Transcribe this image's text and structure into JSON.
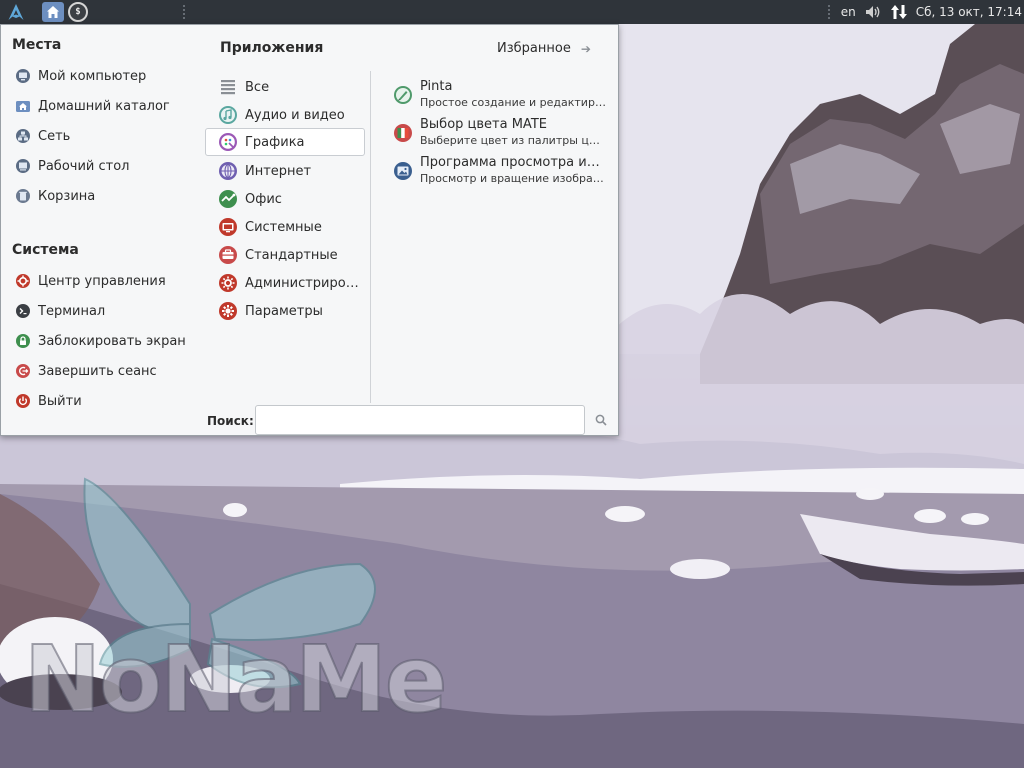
{
  "panel": {
    "keyboard_layout": "en",
    "clock": "Сб, 13 окт, 17:14",
    "terminal_launcher_glyph": "$"
  },
  "menu": {
    "places": {
      "title": "Места",
      "items": [
        {
          "label": "Мой компьютер",
          "icon": "computer-icon"
        },
        {
          "label": "Домашний каталог",
          "icon": "home-folder-icon"
        },
        {
          "label": "Сеть",
          "icon": "network-icon"
        },
        {
          "label": "Рабочий стол",
          "icon": "desktop-icon"
        },
        {
          "label": "Корзина",
          "icon": "trash-icon"
        }
      ]
    },
    "system": {
      "title": "Система",
      "items": [
        {
          "label": "Центр управления",
          "icon": "control-center-icon"
        },
        {
          "label": "Терминал",
          "icon": "terminal-icon"
        },
        {
          "label": "Заблокировать экран",
          "icon": "lock-icon"
        },
        {
          "label": "Завершить сеанс",
          "icon": "logout-icon"
        },
        {
          "label": "Выйти",
          "icon": "power-icon"
        }
      ]
    },
    "applications": {
      "title": "Приложения",
      "favorites_label": "Избранное",
      "categories": [
        {
          "label": "Все",
          "icon": "all-apps-icon",
          "color": "#8a8f95"
        },
        {
          "label": "Аудио и видео",
          "icon": "multimedia-icon",
          "color": "#5aa7a0"
        },
        {
          "label": "Графика",
          "icon": "graphics-icon",
          "color": "#9b59b6",
          "active": true
        },
        {
          "label": "Интернет",
          "icon": "internet-icon",
          "color": "#6f5fb0"
        },
        {
          "label": "Офис",
          "icon": "office-icon",
          "color": "#3e8f4e"
        },
        {
          "label": "Системные",
          "icon": "system-tools-icon",
          "color": "#c0392b"
        },
        {
          "label": "Стандартные",
          "icon": "accessories-icon",
          "color": "#c84a4a"
        },
        {
          "label": "Администриро…",
          "icon": "administration-icon",
          "color": "#c0392b"
        },
        {
          "label": "Параметры",
          "icon": "preferences-icon",
          "color": "#c0392b"
        }
      ],
      "apps": [
        {
          "name": "Pinta",
          "description": "Простое создание и редактиров…",
          "icon": "pinta-icon"
        },
        {
          "name": "Выбор цвета MATE",
          "description": "Выберите цвет из палитры цвет…",
          "icon": "color-picker-icon"
        },
        {
          "name": "Программа просмотра изо…",
          "description": "Просмотр и вращение изображе…",
          "icon": "image-viewer-icon"
        }
      ]
    },
    "search": {
      "label": "Поиск:",
      "value": "",
      "placeholder": ""
    }
  },
  "wallpaper": {
    "watermark": "NoNaMe"
  }
}
